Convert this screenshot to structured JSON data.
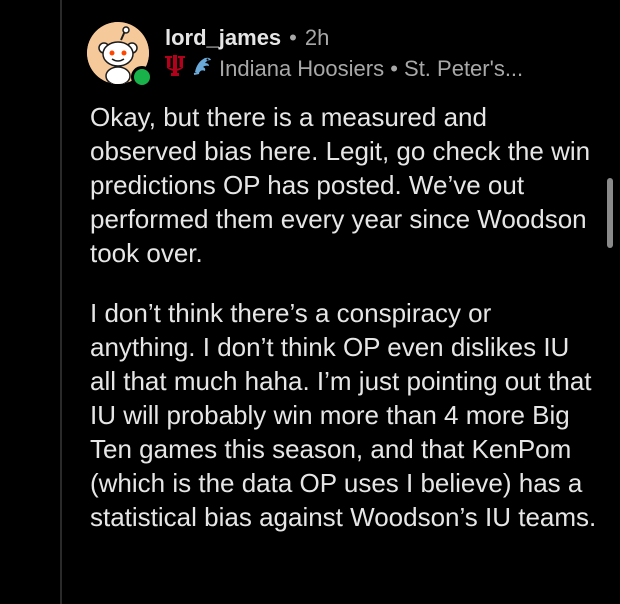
{
  "comment": {
    "username": "lord_james",
    "separator": "•",
    "time": "2h",
    "flair_text": "Indiana Hoosiers • St. Peter's...",
    "paragraphs": [
      "Okay, but there is a measured and observed bias here. Legit, go check the win predictions OP has posted. We’ve out performed them every year since Woodson took over.",
      "I don’t think there’s a conspiracy or anything. I don’t think OP even dislikes IU all that much haha. I’m just pointing out that IU will probably win more than 4 more Big Ten games this season, and that KenPom (which is the data OP uses I believe) has a statistical bias against Woodson’s IU teams."
    ],
    "avatar_icon": "snoo-avatar-icon",
    "online_status": "online-indicator",
    "flair_icons": [
      "iu-logo-icon",
      "peacock-icon"
    ]
  },
  "colors": {
    "background": "#000000",
    "text": "#e6e6e6",
    "muted": "#a8a8a8",
    "online": "#19b24a",
    "iu_crimson": "#b3001b",
    "peacock_blue": "#6aa9d8"
  }
}
